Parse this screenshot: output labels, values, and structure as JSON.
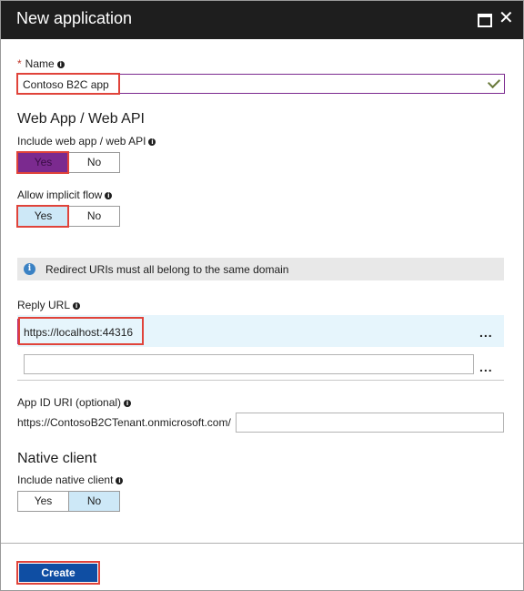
{
  "window": {
    "title": "New application"
  },
  "name_field": {
    "label": "Name",
    "required_mark": "*",
    "value": "Contoso B2C app"
  },
  "web_app": {
    "section_title": "Web App / Web API",
    "include_label": "Include web app / web API",
    "include_options": [
      "Yes",
      "No"
    ],
    "include_selected": "Yes",
    "implicit_label": "Allow implicit flow",
    "implicit_options": [
      "Yes",
      "No"
    ],
    "implicit_selected": "Yes"
  },
  "notice": {
    "text": "Redirect URIs must all belong to the same domain"
  },
  "reply_url": {
    "label": "Reply URL",
    "values": [
      "https://localhost:44316",
      ""
    ],
    "more_label": "..."
  },
  "app_id_uri": {
    "label": "App ID URI (optional)",
    "prefix": "https://ContosoB2CTenant.onmicrosoft.com/",
    "value": ""
  },
  "native_client": {
    "section_title": "Native client",
    "include_label": "Include native client",
    "options": [
      "Yes",
      "No"
    ],
    "selected": "No"
  },
  "footer": {
    "create_label": "Create"
  },
  "colors": {
    "highlight_red": "#e0433a",
    "selected_purple": "#7b2a8f",
    "selected_blue": "#cde8f7",
    "create_blue": "#0f4ea3"
  }
}
